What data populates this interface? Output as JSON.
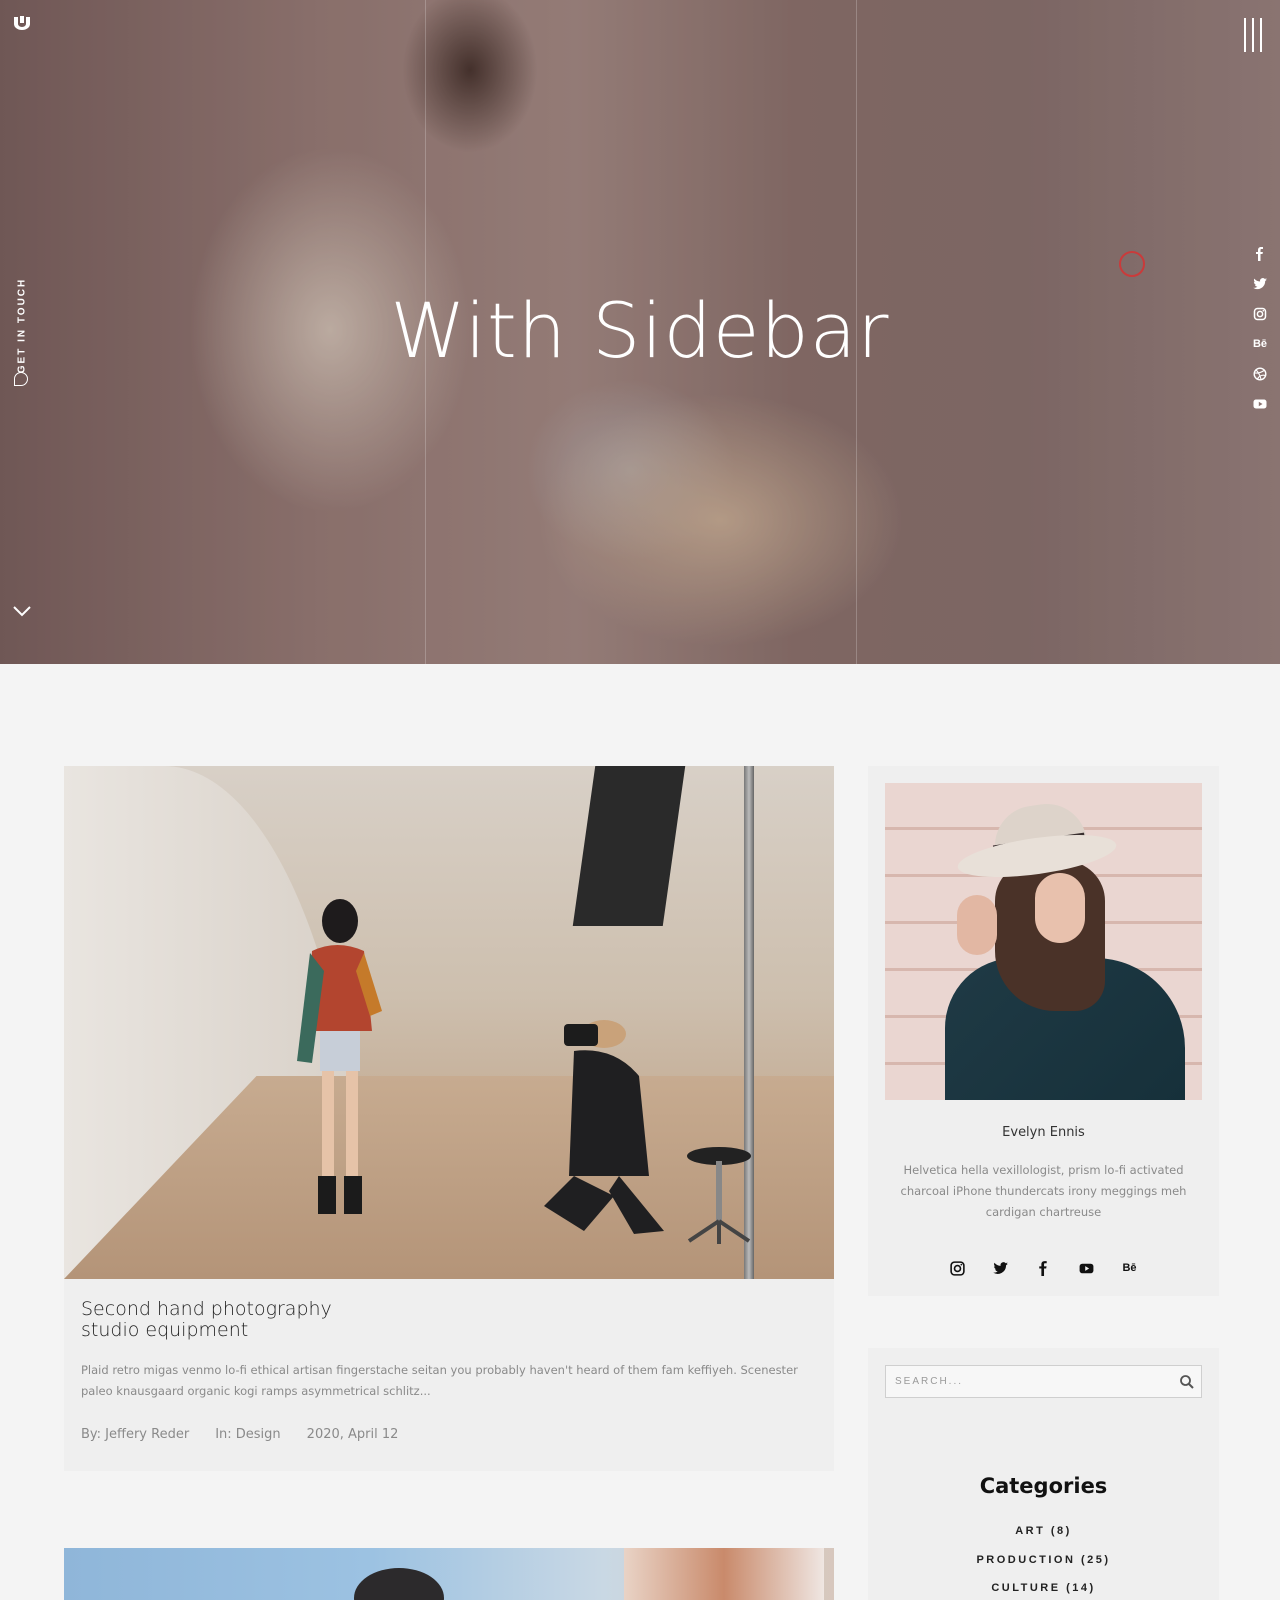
{
  "hero": {
    "title": "With Sidebar",
    "get_in_touch": "GET IN TOUCH"
  },
  "social_rail": {
    "icons": [
      "facebook-icon",
      "twitter-icon",
      "instagram-icon",
      "behance-icon",
      "dribbble-icon",
      "youtube-icon"
    ],
    "behance_label": "Bē"
  },
  "post": {
    "title_line1": "Second hand photography",
    "title_line2": "studio equipment",
    "excerpt": "Plaid retro migas venmo lo-fi ethical artisan fingerstache seitan you probably haven't heard of them fam keffiyeh. Scenester paleo knausgaard organic kogi ramps asymmetrical schlitz...",
    "author": "By: Jeffery Reder",
    "category": "In: Design",
    "date": "2020, April 12"
  },
  "author_card": {
    "name": "Evelyn Ennis",
    "bio": "Helvetica hella vexillologist, prism lo-fi activated charcoal iPhone thundercats irony meggings meh cardigan chartreuse",
    "social": [
      "instagram-icon",
      "twitter-icon",
      "facebook-icon",
      "youtube-icon",
      "behance-icon"
    ],
    "behance_label": "Bē"
  },
  "search": {
    "placeholder": "SEARCH..."
  },
  "categories": {
    "title": "Categories",
    "items": [
      {
        "label": "ART (8)"
      },
      {
        "label": "PRODUCTION (25)"
      },
      {
        "label": "CULTURE (14)"
      }
    ]
  },
  "colors": {
    "accent_cursor": "#c93b3b",
    "card_background": "#efefef",
    "page_background": "#f4f4f4"
  }
}
